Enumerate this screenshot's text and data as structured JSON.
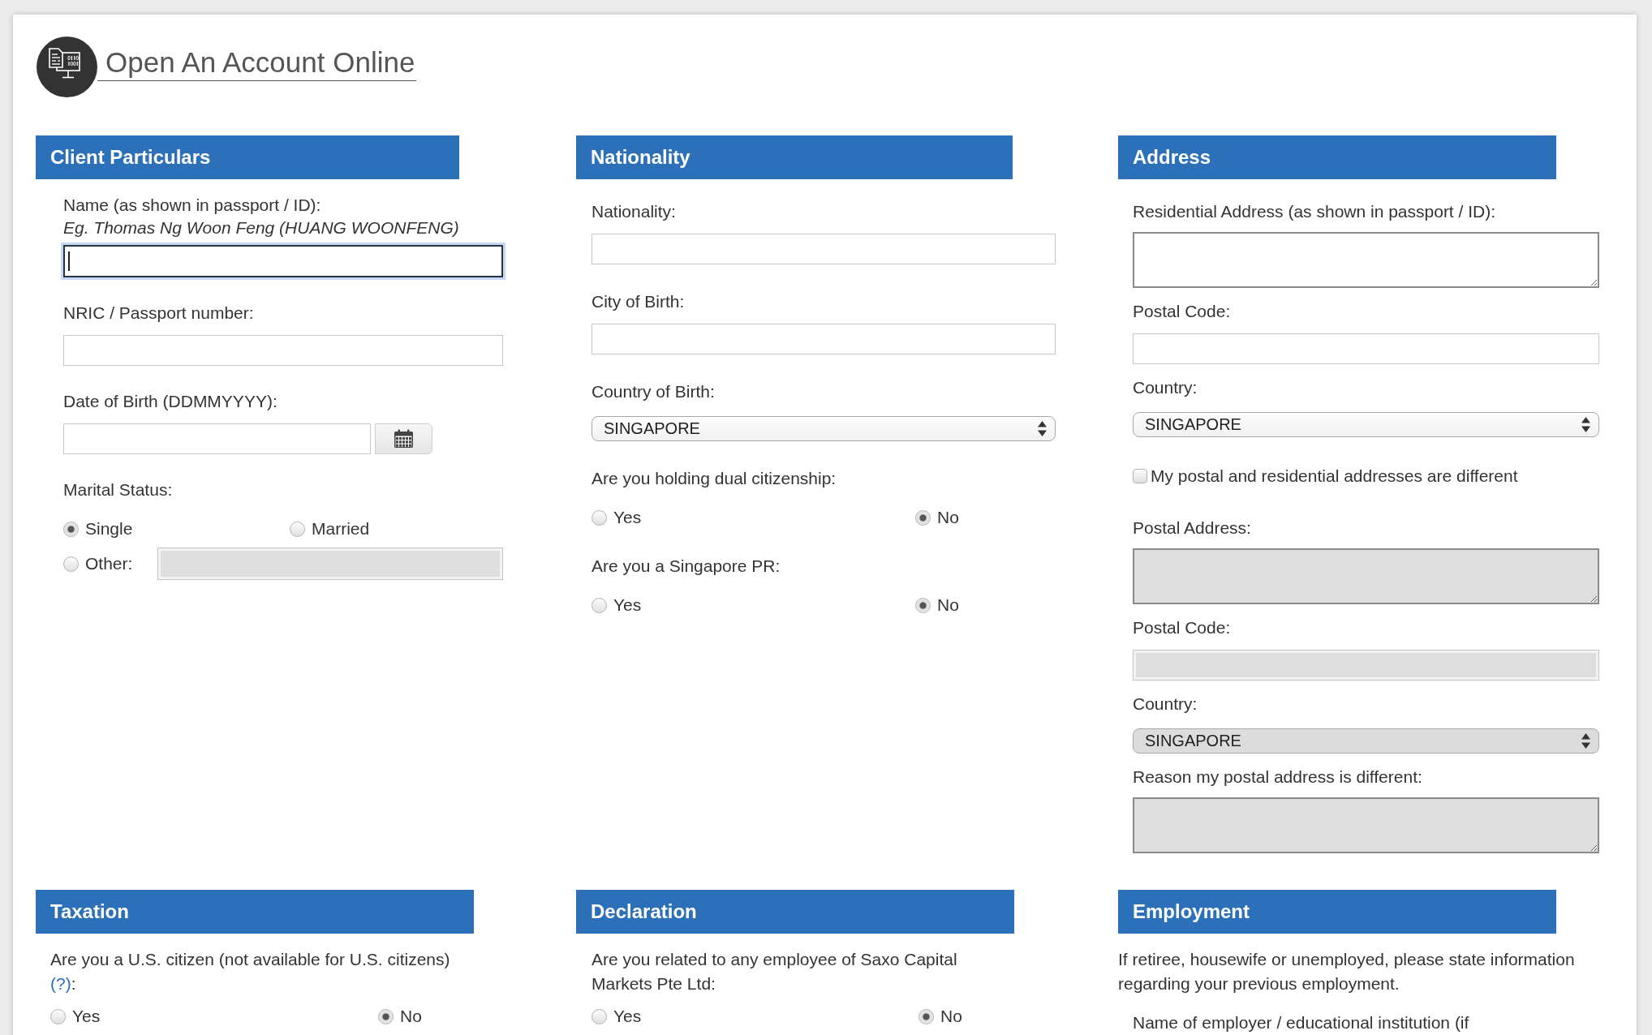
{
  "header": {
    "title": "Open An Account Online"
  },
  "sections": [
    {
      "title": "Client Particulars",
      "fields": [
        {
          "kind": "text",
          "label": "Name (as shown in passport / ID):",
          "hint": "Eg. Thomas Ng Woon Feng (HUANG WOONFENG)",
          "focused": true,
          "disabled": false
        },
        {
          "kind": "text",
          "label": "NRIC / Passport number:",
          "focused": false,
          "disabled": false
        },
        {
          "kind": "date",
          "label": "Date of Birth (DDMMYYYY):"
        },
        {
          "kind": "radio",
          "label": "Marital Status:",
          "options": [
            {
              "label": "Single",
              "selected": true
            },
            {
              "label": "Married",
              "selected": false
            },
            {
              "label": "Other:",
              "selected": false,
              "input": {
                "disabled": true
              }
            }
          ]
        }
      ]
    },
    {
      "title": "Nationality",
      "fields": [
        {
          "kind": "text",
          "label": "Nationality:",
          "focused": false,
          "disabled": false
        },
        {
          "kind": "text",
          "label": "City of Birth:",
          "focused": false,
          "disabled": false
        },
        {
          "kind": "select",
          "label": "Country of Birth:",
          "value": "SINGAPORE",
          "disabled": false
        },
        {
          "kind": "radio",
          "label": "Are you holding dual citizenship:",
          "options": [
            {
              "label": "Yes",
              "selected": false
            },
            {
              "label": "No",
              "selected": true
            }
          ]
        },
        {
          "kind": "radio",
          "label": "Are you a Singapore PR:",
          "options": [
            {
              "label": "Yes",
              "selected": false
            },
            {
              "label": "No",
              "selected": true
            }
          ]
        }
      ]
    },
    {
      "title": "Address",
      "fields": [
        {
          "kind": "textarea",
          "label": "Residential Address (as shown in passport / ID):",
          "disabled": false
        },
        {
          "kind": "text",
          "label": "Postal Code:",
          "focused": false,
          "disabled": false
        },
        {
          "kind": "select",
          "label": "Country:",
          "value": "SINGAPORE",
          "disabled": false
        },
        {
          "kind": "checkbox",
          "label": "My postal and residential addresses are different",
          "checked": false
        },
        {
          "kind": "textarea",
          "label": "Postal Address:",
          "disabled": true
        },
        {
          "kind": "text",
          "label": "Postal Code:",
          "focused": false,
          "disabled": true
        },
        {
          "kind": "select",
          "label": "Country:",
          "value": "SINGAPORE",
          "disabled": true
        },
        {
          "kind": "textarea",
          "label": "Reason my postal address is different:",
          "disabled": true
        }
      ]
    },
    {
      "title": "Taxation",
      "fields": [
        {
          "kind": "radio",
          "label": "Are you a U.S. citizen (not available for U.S. citizens)",
          "link": "(?)",
          "suffix": ":",
          "options": [
            {
              "label": "Yes",
              "selected": false
            },
            {
              "label": "No",
              "selected": true
            }
          ]
        }
      ]
    },
    {
      "title": "Declaration",
      "fields": [
        {
          "kind": "radio",
          "label": "Are you related to any employee of Saxo Capital Markets Pte Ltd:",
          "options": [
            {
              "label": "Yes",
              "selected": false
            },
            {
              "label": "No",
              "selected": true
            }
          ]
        }
      ]
    },
    {
      "title": "Employment",
      "fields": [
        {
          "kind": "note",
          "text": "If retiree, housewife or unemployed, please state information regarding your previous employment."
        },
        {
          "kind": "label",
          "label": "Name of employer / educational institution (if"
        }
      ]
    }
  ]
}
